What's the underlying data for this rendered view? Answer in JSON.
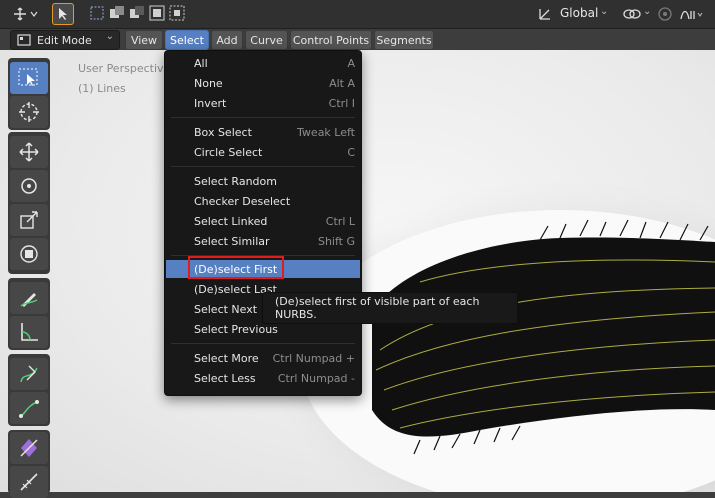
{
  "topbar": {
    "orientation_label": "Global",
    "icons": [
      "cursor-move-icon",
      "select-pointer-icon",
      "box-select-new-icon",
      "box-select-extend-icon",
      "box-select-subtract-icon",
      "box-select-invert-icon",
      "box-select-intersect-icon",
      "transform-orientation-icon",
      "snapping-icon",
      "proportional-edit-icon",
      "falloff-icon"
    ]
  },
  "header": {
    "mode": "Edit Mode",
    "menus": [
      "View",
      "Select",
      "Add",
      "Curve",
      "Control Points",
      "Segments"
    ],
    "active_menu": "Select"
  },
  "viewport": {
    "perspective": "User Perspective",
    "object": "(1) Lines"
  },
  "select_menu": {
    "items": [
      {
        "label": "All",
        "shortcut": "A"
      },
      {
        "label": "None",
        "shortcut": "Alt A"
      },
      {
        "label": "Invert",
        "shortcut": "Ctrl I"
      },
      {
        "label": "Box Select",
        "shortcut": "Tweak Left"
      },
      {
        "label": "Circle Select",
        "shortcut": "C"
      },
      {
        "label": "Select Random",
        "shortcut": ""
      },
      {
        "label": "Checker Deselect",
        "shortcut": ""
      },
      {
        "label": "Select Linked",
        "shortcut": "Ctrl L"
      },
      {
        "label": "Select Similar",
        "shortcut": "Shift G"
      },
      {
        "label": "(De)select First",
        "shortcut": ""
      },
      {
        "label": "(De)select Last",
        "shortcut": ""
      },
      {
        "label": "Select Next",
        "shortcut": ""
      },
      {
        "label": "Select Previous",
        "shortcut": ""
      },
      {
        "label": "Select More",
        "shortcut": "Ctrl Numpad +"
      },
      {
        "label": "Select Less",
        "shortcut": "Ctrl Numpad -"
      }
    ],
    "highlighted": "(De)select First"
  },
  "tooltip": {
    "text": "(De)select first of visible part of each NURBS."
  },
  "colors": {
    "accent": "#5680c2",
    "highlight_box": "#e21b1b",
    "curve_lines": "#c8c84a"
  }
}
